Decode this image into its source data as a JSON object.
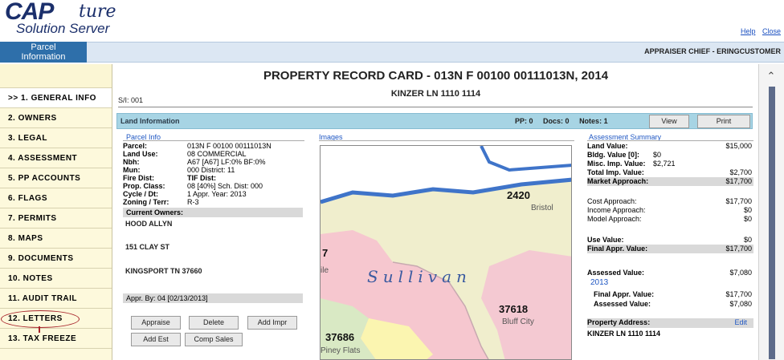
{
  "header": {
    "logo_main": "CAP",
    "logo_script": "ture",
    "logo_sub": "Solution Server",
    "help_label": "Help",
    "close_label": "Close"
  },
  "topbar": {
    "parcel_tab_line1": "Parcel",
    "parcel_tab_line2": "Information",
    "user": "APPRAISER CHIEF - ERINGCUSTOMER"
  },
  "nav": {
    "items": [
      {
        "label": ">> 1. GENERAL INFO"
      },
      {
        "label": "2. OWNERS"
      },
      {
        "label": "3. LEGAL"
      },
      {
        "label": "4. ASSESSMENT"
      },
      {
        "label": "5. PP ACCOUNTS"
      },
      {
        "label": "6. FLAGS"
      },
      {
        "label": "7. PERMITS"
      },
      {
        "label": "8. MAPS"
      },
      {
        "label": "9. DOCUMENTS"
      },
      {
        "label": "10. NOTES"
      },
      {
        "label": "11. AUDIT TRAIL"
      },
      {
        "label": "12. LETTERS"
      },
      {
        "label": "13. TAX FREEZE"
      }
    ]
  },
  "card": {
    "title": "PROPERTY RECORD CARD - 013N F 00100 00111013N, 2014",
    "address": "KINZER LN 1110 1114",
    "sn": "S/I: 001"
  },
  "land_bar": {
    "title": "Land Information",
    "pp": "PP: 0",
    "docs": "Docs: 0",
    "notes": "Notes: 1",
    "view_label": "View",
    "print_label": "Print"
  },
  "parcel_info": {
    "section_title": "Parcel Info",
    "parcel_label": "Parcel:",
    "parcel_value": "013N F 00100 00111013N",
    "land_use_label": "Land Use:",
    "land_use_value": "08 COMMERCIAL",
    "nbh_label": "Nbh:",
    "nbh_value": "A67  [A67]   LF:0%    BF:0%",
    "mun_label": "Mun:",
    "mun_value": "000   District: 11",
    "fire_label": "Fire Dist:",
    "tif_label": "TIF Dist:",
    "prop_class_label": "Prop. Class:",
    "prop_class_value": "08  [40%]   Sch. Dist: 000",
    "cycle_label": "Cycle / Dt:",
    "cycle_value": "1        Appr. Year: 2013",
    "zoning_label": "Zoning / Terr:",
    "zoning_value": "R-3",
    "current_owners_label": "Current Owners:",
    "owner_name": "HOOD ALLYN",
    "owner_street": "151 CLAY ST",
    "owner_city": "KINGSPORT TN 37660",
    "appr_by": "Appr. By: 04 [02/13/2013]",
    "buttons": {
      "appraise": "Appraise",
      "delete": "Delete",
      "add_impr": "Add Impr",
      "add_est": "Add Est",
      "comp_sales": "Comp Sales"
    }
  },
  "images": {
    "section_title": "Images",
    "map_labels": {
      "zip_top": "2420",
      "town_top": "Bristol",
      "county": "Sullivan",
      "zip_right": "37618",
      "town_right": "Bluff City",
      "zip_left": "37686",
      "town_left": "Piney Flats",
      "left_fragment_a": "7",
      "left_fragment_b": "ile"
    }
  },
  "assessment": {
    "section_title": "Assessment Summary",
    "land_value_label": "Land Value:",
    "land_value": "$15,000",
    "bldg_label": "Bldg. Value [0]:",
    "bldg_value": "$0",
    "misc_label": "Misc. Imp. Value:",
    "misc_value": "$2,721",
    "total_imp_label": "Total Imp. Value:",
    "total_imp_value": "$2,700",
    "market_label": "Market Approach:",
    "market_value": "$17,700",
    "cost_label": "Cost Approach:",
    "cost_value": "$17,700",
    "income_label": "Income Approach:",
    "income_value": "$0",
    "model_label": "Model Approach:",
    "model_value": "$0",
    "use_label": "Use Value:",
    "use_value": "$0",
    "final_label": "Final Appr. Value:",
    "final_value": "$17,700",
    "assessed_label": "Assessed Value:",
    "assessed_value": "$7,080",
    "year": "2013",
    "year_final_label": "Final Appr. Value:",
    "year_final_value": "$17,700",
    "year_assessed_label": "Assessed Value:",
    "year_assessed_value": "$7,080",
    "property_address_label": "Property Address:",
    "edit_label": "Edit",
    "property_address_value": "KINZER LN 1110 1114"
  },
  "colors": {
    "nav_bg": "#fdf9dc",
    "tab_blue": "#2e6faa",
    "land_bar": "#a7d4e4",
    "link_blue": "#1f57c3",
    "highlight_red": "#a8242b"
  }
}
